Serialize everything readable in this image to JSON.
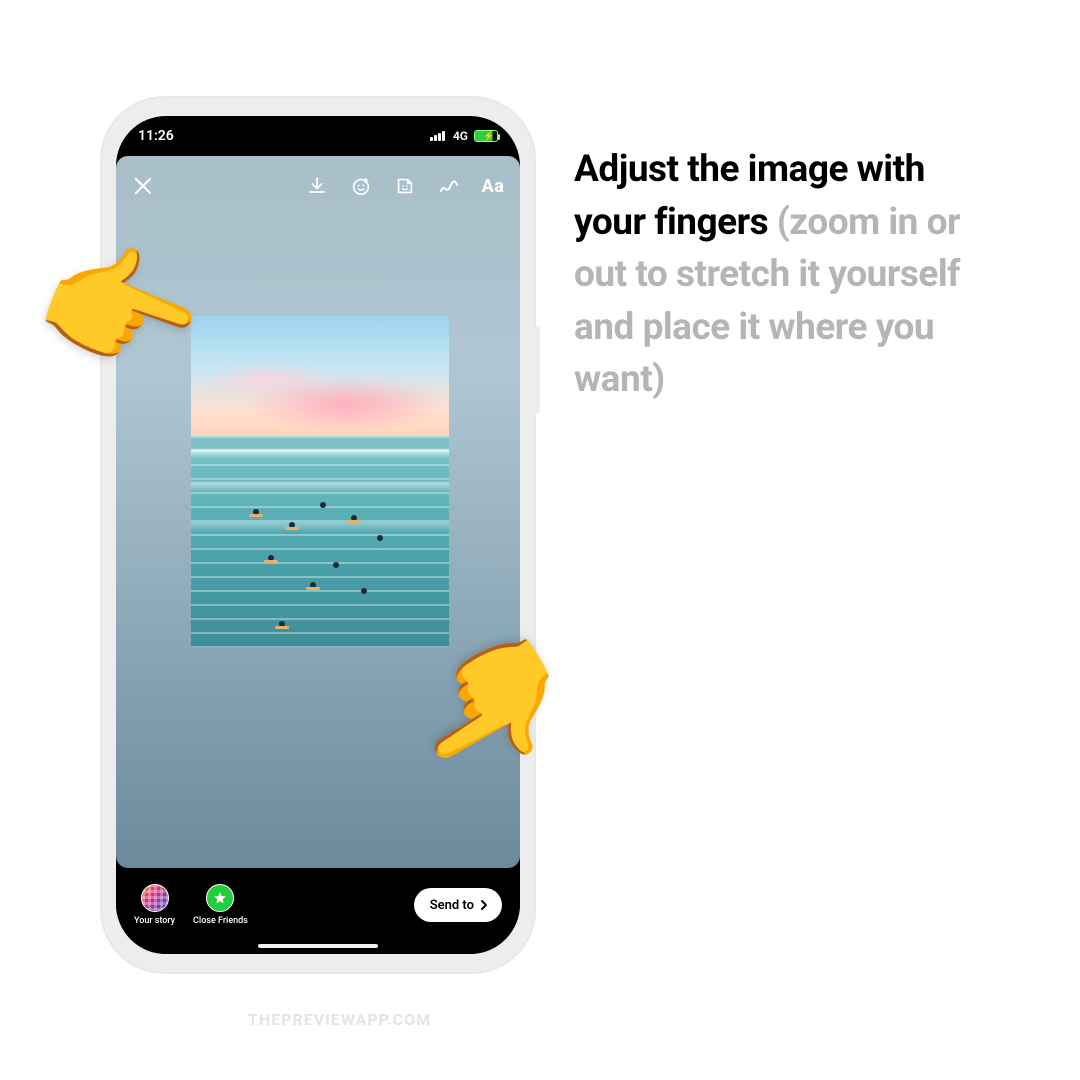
{
  "statusbar": {
    "time": "11:26",
    "net_label": "4G"
  },
  "story": {
    "tools": {
      "text_tool_label": "Aa"
    }
  },
  "bottom": {
    "your_story_label": "Your story",
    "close_friends_label": "Close Friends",
    "send_label": "Send to"
  },
  "copy": {
    "bold_part": "Adjust the image with your fingers ",
    "muted_part": "(zoom in or out to stretch it yourself and place it where you want)"
  },
  "hand_glyph": "👉",
  "watermark": "THEPREVIEWAPP.COM"
}
